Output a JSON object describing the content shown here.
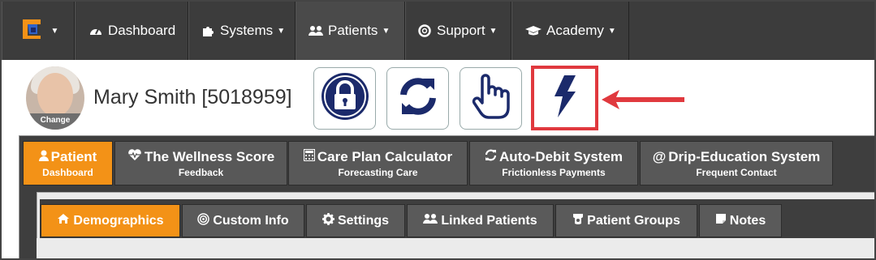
{
  "colors": {
    "nav_bg": "#3c3c3c",
    "accent_orange": "#f39217",
    "tab_gray": "#585858",
    "icon_navy": "#1b2a6b",
    "highlight_red": "#e0393e"
  },
  "topnav": {
    "logo_icon": "app-logo-icon",
    "items": [
      {
        "label": "Dashboard",
        "icon": "tachometer-icon",
        "has_caret": false
      },
      {
        "label": "Systems",
        "icon": "puzzle-icon",
        "has_caret": true
      },
      {
        "label": "Patients",
        "icon": "users-icon",
        "has_caret": true
      },
      {
        "label": "Support",
        "icon": "lifebuoy-icon",
        "has_caret": true
      },
      {
        "label": "Academy",
        "icon": "graduation-cap-icon",
        "has_caret": true
      }
    ]
  },
  "patient": {
    "name": "Mary Smith [5018959]",
    "avatar_change_label": "Change"
  },
  "actions": [
    {
      "icon": "lock-icon"
    },
    {
      "icon": "refresh-icon"
    },
    {
      "icon": "hand-pointer-icon"
    },
    {
      "icon": "bolt-icon",
      "highlighted": true
    }
  ],
  "main_tabs": [
    {
      "label": "Patient",
      "sub": "Dashboard",
      "icon": "user-icon",
      "active": true
    },
    {
      "label": "The Wellness Score",
      "sub": "Feedback",
      "icon": "heartbeat-icon",
      "active": false
    },
    {
      "label": "Care Plan Calculator",
      "sub": "Forecasting Care",
      "icon": "calculator-icon",
      "active": false
    },
    {
      "label": "Auto-Debit System",
      "sub": "Frictionless Payments",
      "icon": "refresh-icon",
      "active": false
    },
    {
      "label": "Drip-Education System",
      "sub": "Frequent Contact",
      "icon": "at-icon",
      "active": false
    }
  ],
  "sub_tabs": [
    {
      "label": "Demographics",
      "icon": "home-icon",
      "active": true
    },
    {
      "label": "Custom Info",
      "icon": "bullseye-icon",
      "active": false
    },
    {
      "label": "Settings",
      "icon": "cog-icon",
      "active": false
    },
    {
      "label": "Linked Patients",
      "icon": "users-icon",
      "active": false
    },
    {
      "label": "Patient Groups",
      "icon": "group-icon",
      "active": false
    },
    {
      "label": "Notes",
      "icon": "sticky-note-icon",
      "active": false
    }
  ]
}
